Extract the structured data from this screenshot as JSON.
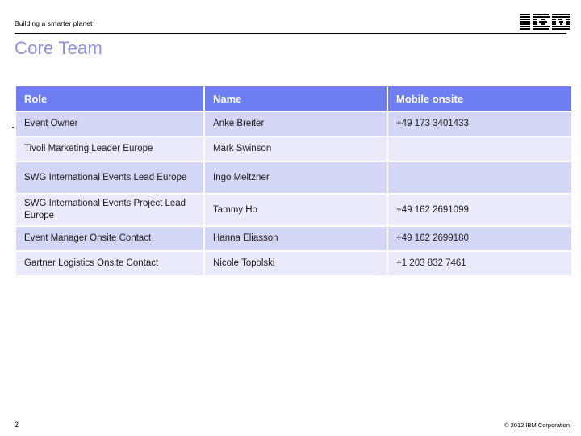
{
  "header": {
    "tagline": "Building a smarter planet",
    "logo_name": "ibm-logo"
  },
  "title": "Core Team",
  "table": {
    "columns": [
      "Role",
      "Name",
      "Mobile onsite"
    ],
    "rows": [
      {
        "role": "Event Owner",
        "name": "Anke Breiter",
        "mobile": "+49 173 3401433"
      },
      {
        "role": "Tivoli Marketing Leader Europe",
        "name": "Mark Swinson",
        "mobile": ""
      },
      {
        "role": "SWG International Events Lead Europe",
        "name": "Ingo Meltzner",
        "mobile": ""
      },
      {
        "role": "SWG International Events Project Lead Europe",
        "name": "Tammy Ho",
        "mobile": "+49 162 2691099"
      },
      {
        "role": "Event Manager  Onsite Contact",
        "name": "Hanna Eliasson",
        "mobile": "+49 162 2699180"
      },
      {
        "role": "Gartner Logistics Onsite Contact",
        "name": "Nicole Topolski",
        "mobile": "+1 203 832 7461"
      }
    ]
  },
  "footer": {
    "page_number": "2",
    "copyright": "© 2012 IBM Corporation"
  },
  "colors": {
    "header_blue": "#6e7ef0",
    "row_dark": "#d3d6f4",
    "row_light": "#e9ebfb",
    "title_blue": "#8c93d9"
  }
}
